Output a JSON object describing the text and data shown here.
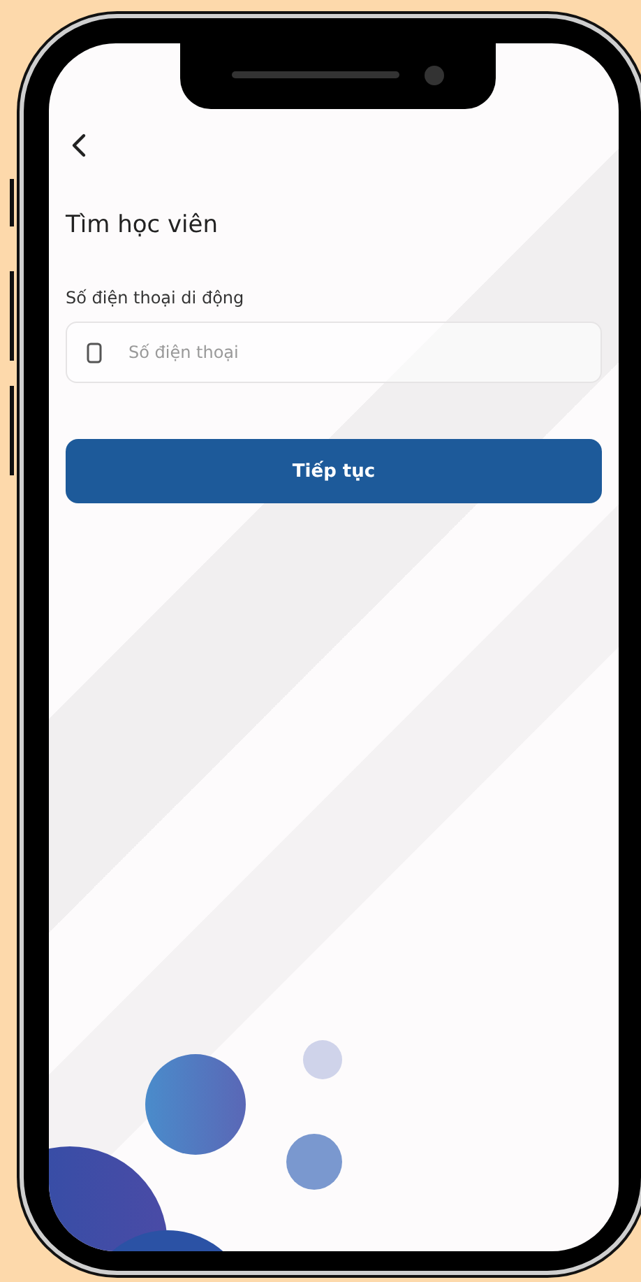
{
  "screen": {
    "title": "Tìm học viên",
    "phone_label": "Số điện thoại di động",
    "phone_field": {
      "placeholder": "Số điện thoại"
    },
    "continue_button": "Tiếp tục"
  }
}
